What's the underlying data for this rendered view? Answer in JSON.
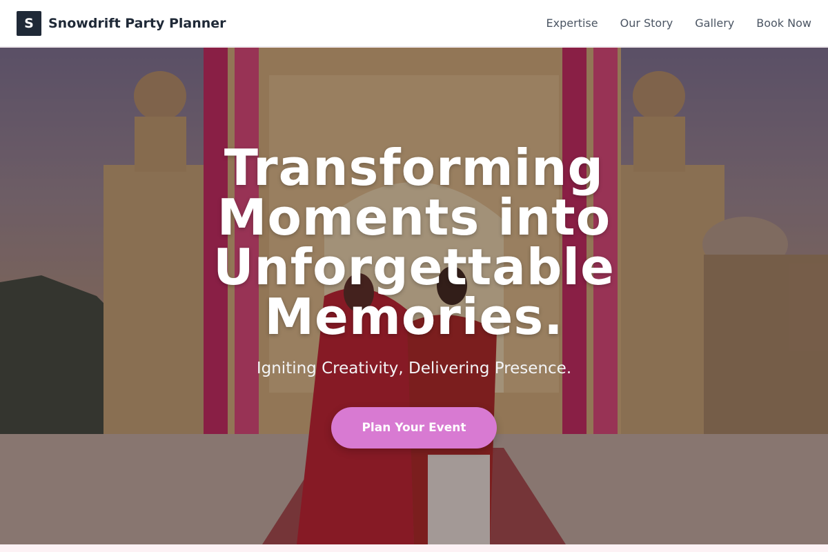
{
  "brand": {
    "logo_letter": "S",
    "name": "Snowdrift Party Planner"
  },
  "nav": {
    "items": [
      "Expertise",
      "Our Story",
      "Gallery",
      "Book Now"
    ]
  },
  "hero": {
    "title": "Transforming Moments into Unforgettable Memories.",
    "subtitle": "Igniting Creativity, Delivering Presence.",
    "cta_label": "Plan Your Event"
  },
  "colors": {
    "cta": "#d87ad2",
    "logo_bg": "#1f2937",
    "nav_text": "#4b5563"
  }
}
